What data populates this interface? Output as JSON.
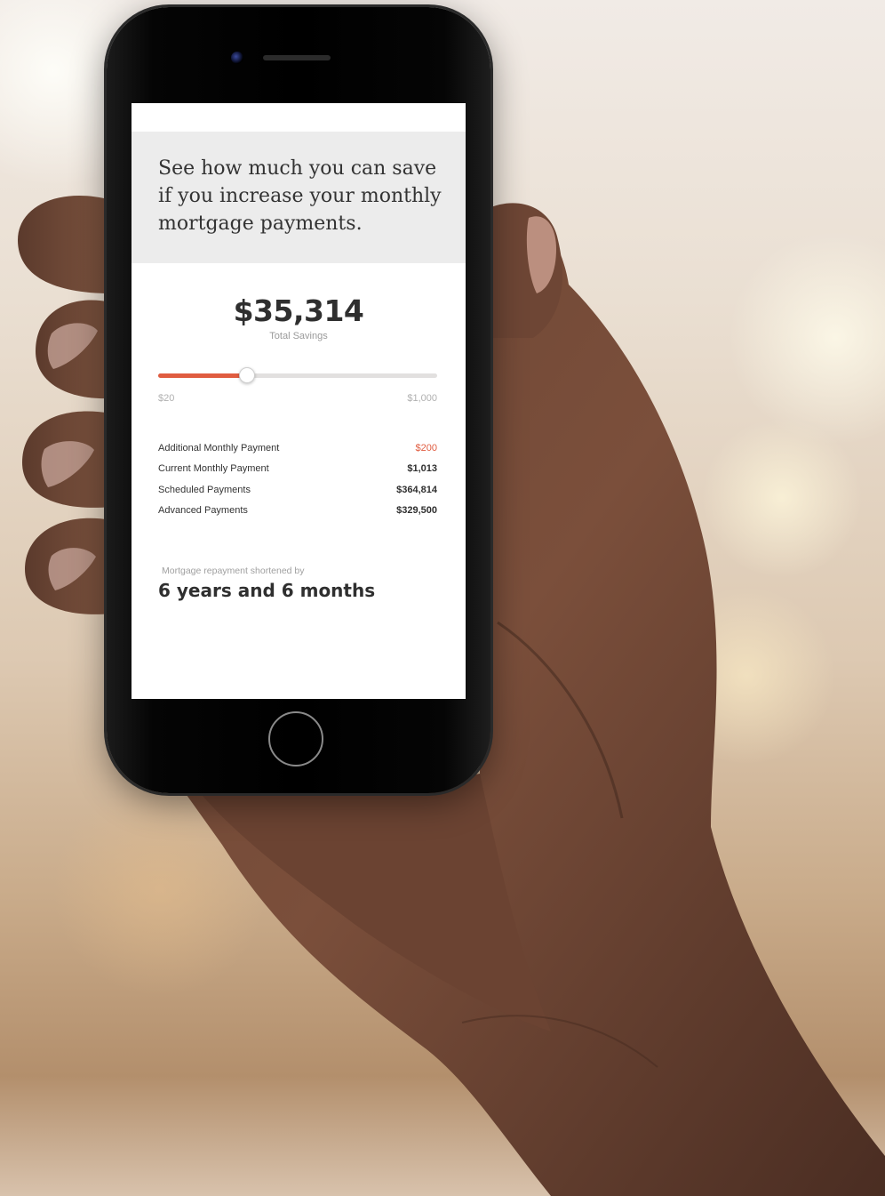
{
  "colors": {
    "accent": "#e05c40",
    "header_bg": "#ececec",
    "text_dark": "#2f2f2f",
    "text_muted": "#9a9a9a"
  },
  "header": {
    "headline": "See how much you can save if you increase your monthly mortgage payments."
  },
  "savings": {
    "total_value": "$35,314",
    "total_label": "Total Savings"
  },
  "slider": {
    "min_label": "$20",
    "max_label": "$1,000",
    "level_fraction": 0.32
  },
  "rows": [
    {
      "label": "Additional Monthly Payment",
      "value": "$200",
      "accent": true
    },
    {
      "label": "Current Monthly Payment",
      "value": "$1,013",
      "accent": false
    },
    {
      "label": "Scheduled Payments",
      "value": "$364,814",
      "accent": false
    },
    {
      "label": "Advanced Payments",
      "value": "$329,500",
      "accent": false
    }
  ],
  "result": {
    "label": "Mortgage repayment shortened by",
    "value": "6 years and 6 months"
  },
  "icons": {
    "camera": "camera-icon",
    "home": "home-button-icon"
  }
}
